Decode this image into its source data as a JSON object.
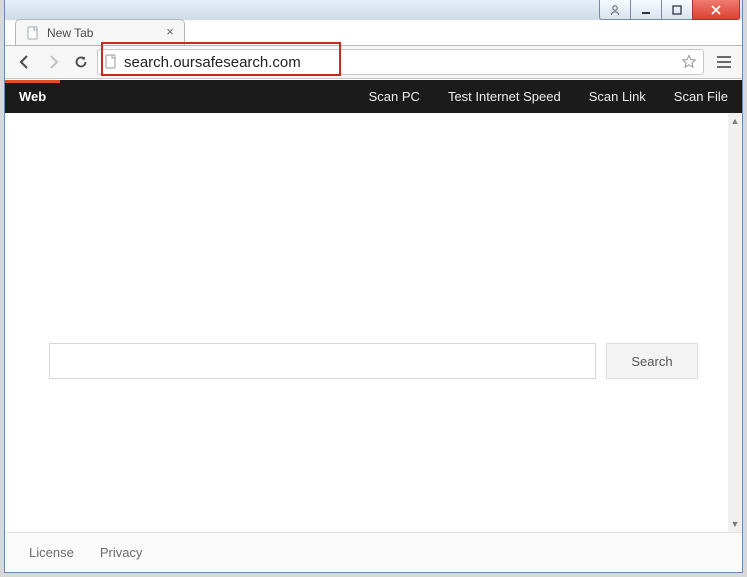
{
  "window": {
    "tab_title": "New Tab"
  },
  "toolbar": {
    "url": "search.oursafesearch.com"
  },
  "page": {
    "topbar": {
      "web_label": "Web",
      "links": [
        "Scan PC",
        "Test Internet Speed",
        "Scan Link",
        "Scan File"
      ]
    },
    "search": {
      "button_label": "Search"
    },
    "footer": {
      "links": [
        "License",
        "Privacy"
      ]
    }
  }
}
